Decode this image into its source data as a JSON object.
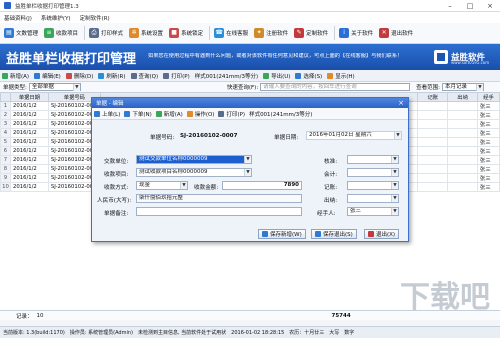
{
  "window": {
    "title": "益胜单栏收据打印管理1.3"
  },
  "menu": [
    "基础资料(J)",
    "系统维护(Y)",
    "定制软件(R)"
  ],
  "toolbar": [
    {
      "label": "文数管理",
      "color": "#2e7bd6"
    },
    {
      "label": "收款项目",
      "color": "#3aa657"
    },
    {
      "label": "打印样式",
      "color": "#5a6b8c"
    },
    {
      "label": "系统设置",
      "color": "#e08a2b"
    },
    {
      "label": "系统锁定",
      "color": "#c94a4a"
    },
    {
      "label": "在线客服",
      "color": "#2a8fd6"
    },
    {
      "label": "注册软件",
      "color": "#d08a2a"
    },
    {
      "label": "定制软件",
      "color": "#c43a3a"
    },
    {
      "label": "关于软件",
      "color": "#2a6fd6"
    },
    {
      "label": "退出软件",
      "color": "#c43a3a"
    }
  ],
  "banner": {
    "title": "益胜单栏收据打印管理",
    "message": "如果您在使用过程中有遇到什么问题，或者对该软件有任何意见和建议，可点上面的【在线客服】与我们联系！",
    "logo_name": "益胜软件",
    "logo_url": "www.soft0595.com"
  },
  "subtoolbar": [
    "新增(A)",
    "编辑(E)",
    "删除(D)",
    "刷新(R)",
    "查询(Q)",
    "打印(P)",
    "样式001(241mm/3等分)",
    "导出(U)",
    "选择(S)",
    "显示(H)"
  ],
  "filter": {
    "type_label": "单据类型:",
    "type_value": "全部单据",
    "quick_label": "快速查询(F):",
    "quick_placeholder": "请输入要查询的内容，按回车进行查询",
    "range_label": "查看范围:",
    "range_value": "本月记录"
  },
  "grid": {
    "headers": [
      "单据日期",
      "单据号码",
      "记账",
      "出纳",
      "经手"
    ],
    "rows": [
      {
        "no": "1",
        "date": "2016/1/2",
        "code": "SJ-20160102-0001",
        "handler": "张三"
      },
      {
        "no": "2",
        "date": "2016/1/2",
        "code": "SJ-20160102-0002",
        "handler": "张三"
      },
      {
        "no": "3",
        "date": "2016/1/2",
        "code": "SJ-20160102-0003",
        "handler": "张三"
      },
      {
        "no": "4",
        "date": "2016/1/2",
        "code": "SJ-20160102-0004",
        "handler": "张三"
      },
      {
        "no": "5",
        "date": "2016/1/2",
        "code": "SJ-20160102-0005",
        "handler": "张三"
      },
      {
        "no": "6",
        "date": "2016/1/2",
        "code": "SJ-20160102-0006",
        "handler": "张三"
      },
      {
        "no": "7",
        "date": "2016/1/2",
        "code": "SJ-20160102-0007",
        "handler": "张三"
      },
      {
        "no": "8",
        "date": "2016/1/2",
        "code": "SJ-20160102-0008",
        "handler": "张三"
      },
      {
        "no": "9",
        "date": "2016/1/2",
        "code": "SJ-20160102-0009",
        "handler": "张三"
      },
      {
        "no": "10",
        "date": "2016/1/2",
        "code": "SJ-20160102-0010",
        "handler": "张三"
      }
    ]
  },
  "summary": {
    "label": "记录：",
    "count": "10",
    "total": "75744"
  },
  "dialog": {
    "title": "单据 - 编辑",
    "toolbar": [
      "上单(L)",
      "下单(N)",
      "新增(A)",
      "操作(O)",
      "打印(P)",
      "样式001(241mm/3等分)"
    ],
    "receipt_no_label": "单据号码:",
    "receipt_no": "SJ-20160102-0007",
    "date_label": "单据日期:",
    "date_value": "2016年01月02日 星期六",
    "payer_label": "交款单位:",
    "payer_value": "测试交款单位名称0000009",
    "item_label": "收款项目:",
    "item_value": "测试收款项目名称0000009",
    "method_label": "收款方式:",
    "method_value": "现金",
    "amount_label": "收款金额:",
    "amount_value": "7890",
    "rmb_label": "人民币(大写):",
    "rmb_value": "柒仟捌佰玖拾元整",
    "note_label": "单据备注:",
    "note_value": "",
    "approver_label": "核准:",
    "accountant_label": "会计:",
    "bookkeeper_label": "记账:",
    "cashier_label": "出纳:",
    "handler_label": "经手人:",
    "handler_value": "张三",
    "save_new": "保存新增(W)",
    "save_exit": "保存退出(S)",
    "exit": "退出(X)"
  },
  "statusbar": {
    "version": "当前版本: 1.3(build:1170)",
    "operator": "操作员: 系统管理员(Admin)",
    "server": "未检测到主目信息, 当前软件处于试用状",
    "datetime": "2016-01-02 18:28:15",
    "lunar": "农历：十月廿三",
    "caps": "大写",
    "num": "数字"
  },
  "watermark": "下载吧"
}
